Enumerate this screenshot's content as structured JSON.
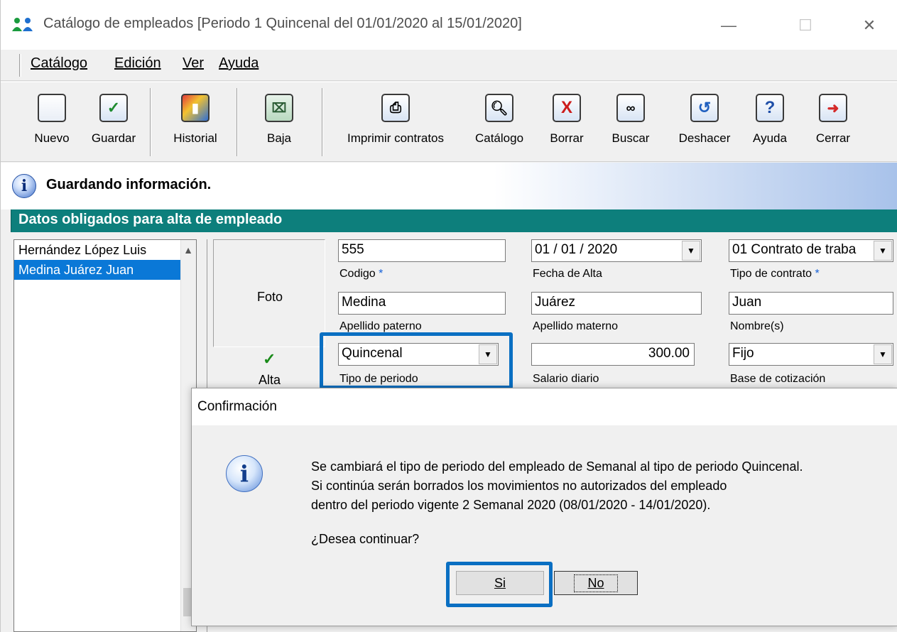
{
  "window": {
    "title": "Catálogo de empleados  [Periodo 1 Quincenal del 01/01/2020 al 15/01/2020]",
    "minimize": "—",
    "maximize": "☐",
    "close": "✕"
  },
  "menu": {
    "items": [
      "Catálogo",
      "Edición",
      "Ver",
      "Ayuda"
    ]
  },
  "toolbar": {
    "buttons": [
      {
        "label": "Nuevo",
        "icon": "new-document-icon"
      },
      {
        "label": "Guardar",
        "icon": "checkmark-icon"
      },
      {
        "label": "Historial",
        "icon": "history-icon"
      },
      {
        "label": "Baja",
        "icon": "remove-person-icon"
      },
      {
        "label": "Imprimir contratos",
        "icon": "printer-icon"
      },
      {
        "label": "Catálogo",
        "icon": "catalog-search-icon"
      },
      {
        "label": "Borrar",
        "icon": "delete-x-icon"
      },
      {
        "label": "Buscar",
        "icon": "binoculars-icon"
      },
      {
        "label": "Deshacer",
        "icon": "undo-icon"
      },
      {
        "label": "Ayuda",
        "icon": "help-icon"
      },
      {
        "label": "Cerrar",
        "icon": "exit-icon"
      }
    ]
  },
  "status": {
    "message": "Guardando información."
  },
  "section": {
    "title": "Datos obligados para alta de empleado"
  },
  "employees": {
    "items": [
      "Hernández López Luis",
      "Medina Juárez Juan"
    ],
    "selected": "Medina Juárez Juan"
  },
  "form": {
    "photo_label": "Foto",
    "alta_label": "Alta",
    "codigo": {
      "value": "555",
      "label": "Codigo"
    },
    "fecha_alta": {
      "value": "01 / 01 / 2020",
      "label": "Fecha de Alta"
    },
    "tipo_contrato": {
      "value": "01 Contrato de traba",
      "label": "Tipo de contrato"
    },
    "apellido_paterno": {
      "value": "Medina",
      "label": "Apellido paterno"
    },
    "apellido_materno": {
      "value": "Juárez",
      "label": "Apellido materno"
    },
    "nombre": {
      "value": "Juan",
      "label": "Nombre(s)"
    },
    "tipo_periodo": {
      "value": "Quincenal",
      "label": "Tipo de periodo"
    },
    "salario_diario": {
      "value": "300.00",
      "label": "Salario diario"
    },
    "base_cotizacion": {
      "value": "Fijo",
      "label": "Base de cotización"
    },
    "required_mark": "*"
  },
  "dialog": {
    "title": "Confirmación",
    "message_line1": "Se cambiará el tipo de periodo del empleado de Semanal al tipo de periodo Quincenal.",
    "message_line2": "Si continúa serán borrados los movimientos no autorizados del empleado",
    "message_line3": "dentro del periodo vigente 2 Semanal 2020 (08/01/2020 - 14/01/2020).",
    "question": "¿Desea continuar?",
    "yes_label": "Si",
    "no_label": "No"
  },
  "colors": {
    "section_header_bg": "#0d7f7c",
    "selected_item_bg": "#0a78d7",
    "highlight_border": "#0a6fc2"
  }
}
